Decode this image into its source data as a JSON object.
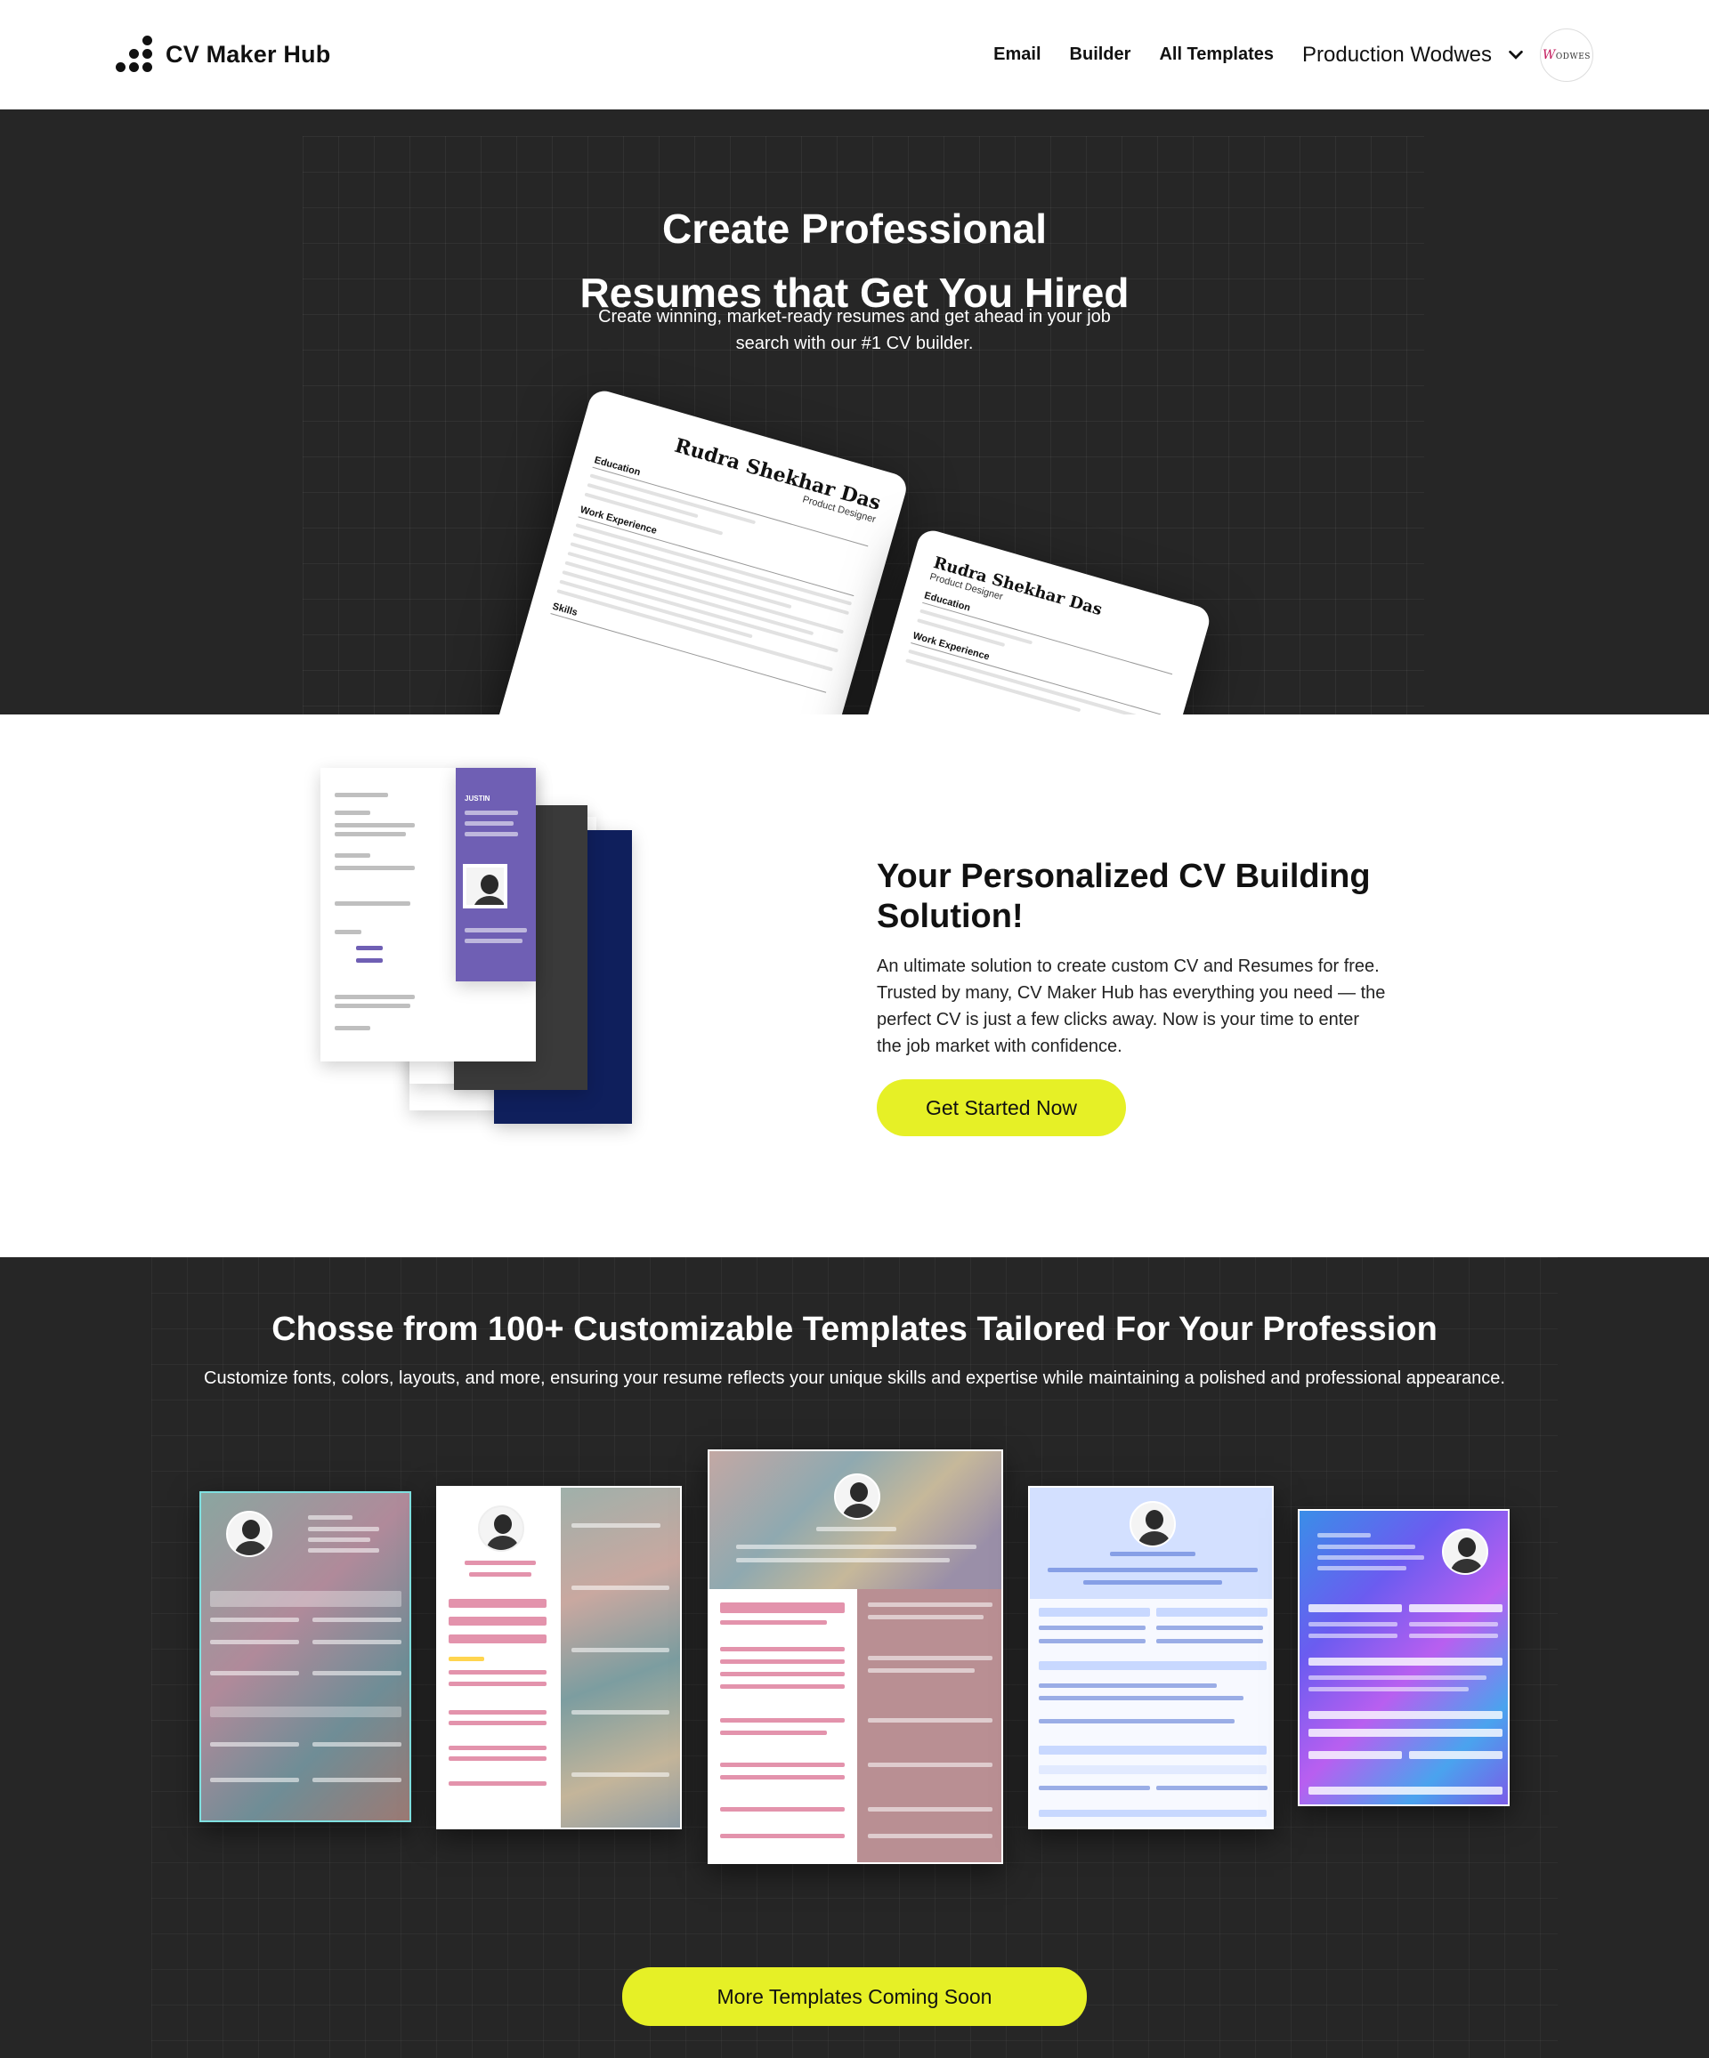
{
  "nav": {
    "logo_text": "CV Maker Hub",
    "links": [
      "Email",
      "Builder",
      "All Templates"
    ],
    "user_name": "Production Wodwes",
    "avatar_text": "ODWES",
    "avatar_initial": "W"
  },
  "hero": {
    "title_line1": "Create Professional",
    "title_line2": "Resumes that Get You Hired",
    "subtitle": "Create winning, market-ready resumes and get ahead in your job search with our #1 CV builder.",
    "cv_name": "Rudra Shekhar Das",
    "cv_role": "Product Designer",
    "cv_sections": [
      "Education",
      "Work Experience",
      "Skills"
    ]
  },
  "personalized": {
    "title": "Your Personalized CV Building Solution!",
    "text": "An ultimate solution to create custom CV and Resumes for free. Trusted by many, CV Maker Hub has everything you need — the perfect CV is just a few clicks away. Now is your time to enter the job market with confidence.",
    "cta": "Get Started Now",
    "preview_name": "JUSTIN"
  },
  "templates": {
    "title": "Chosse from 100+ Customizable Templates Tailored For Your Profession",
    "subtitle": "Customize fonts, colors, layouts, and more, ensuring your resume reflects your unique skills and expertise while maintaining a polished and professional appearance.",
    "cta": "More Templates Coming Soon"
  },
  "colors": {
    "accent": "#e6f026",
    "dark_bg": "#262626",
    "purple": "#6f5fb4",
    "navy": "#0f1f5c"
  }
}
